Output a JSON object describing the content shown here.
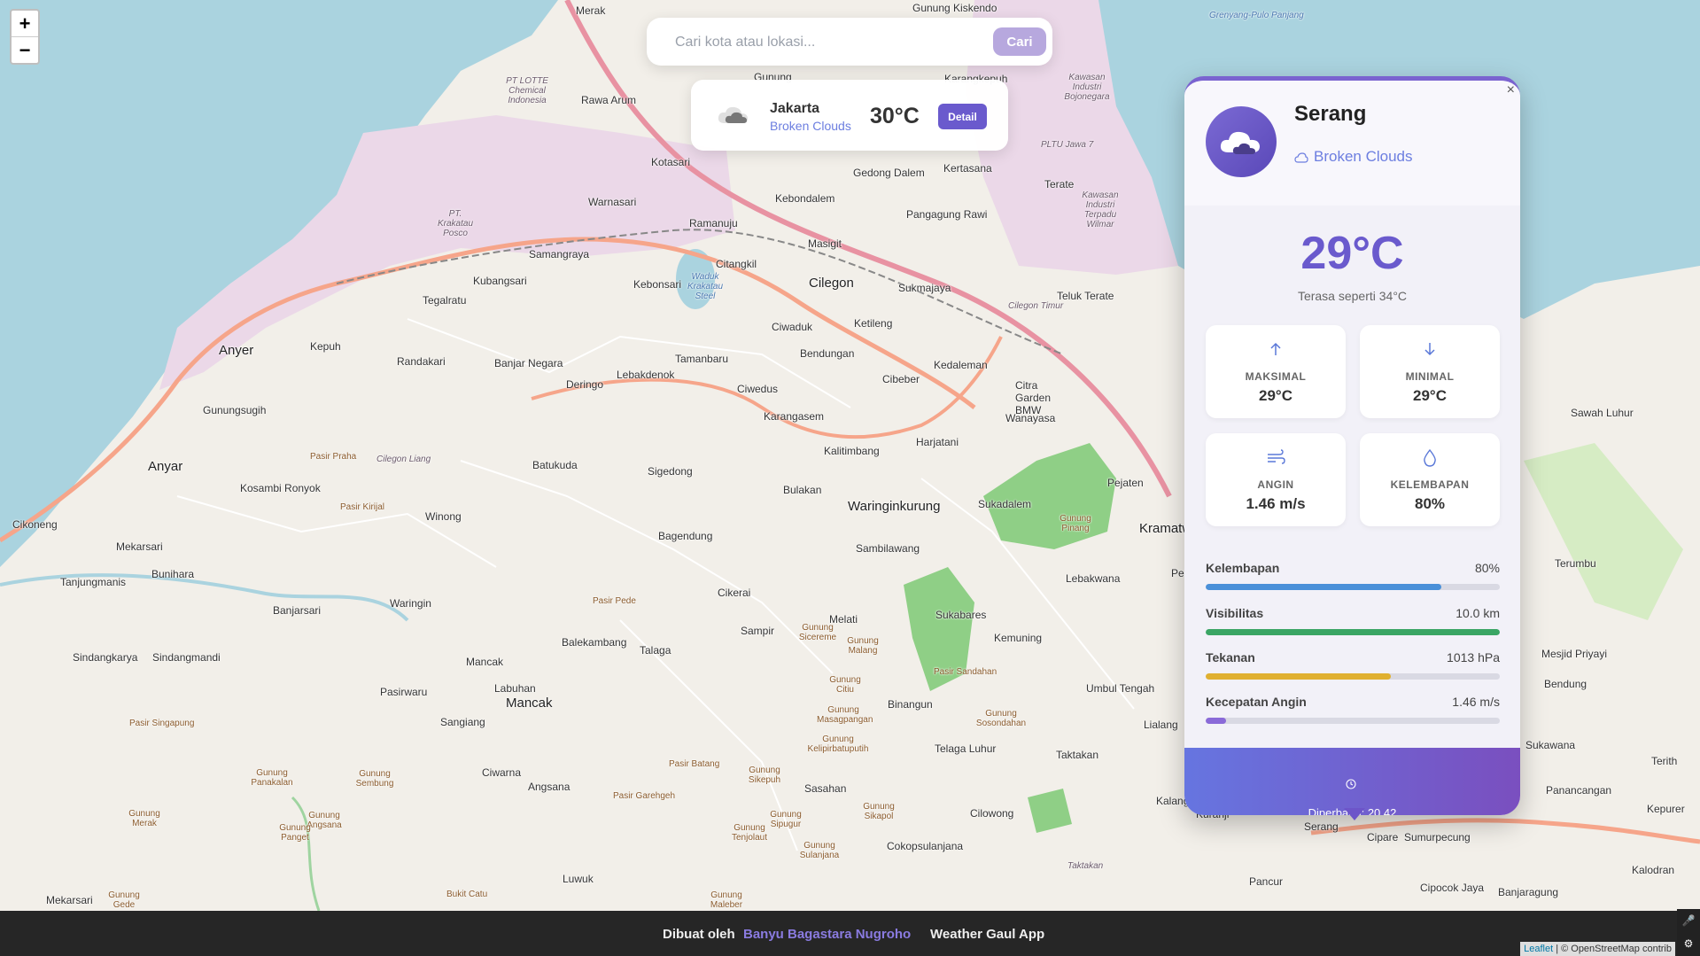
{
  "map": {
    "colors": {
      "sea": "#aad3df",
      "land": "#f2efe9",
      "industrial": "#ebd8e8",
      "forest": "#8fcf86",
      "motorway": "#e892a2",
      "primary": "#f6a58a"
    },
    "labels": [
      {
        "text": "Merak",
        "cls": ""
      },
      {
        "text": "Rawa Arum",
        "cls": ""
      },
      {
        "text": "Kotasari",
        "cls": ""
      },
      {
        "text": "Warnasari",
        "cls": ""
      },
      {
        "text": "Ramanuju",
        "cls": ""
      },
      {
        "text": "Kebondalem",
        "cls": ""
      },
      {
        "text": "Gedong Dalem",
        "cls": ""
      },
      {
        "text": "Kertasana",
        "cls": ""
      },
      {
        "text": "Pangagung Rawi",
        "cls": ""
      },
      {
        "text": "Masigit",
        "cls": ""
      },
      {
        "text": "Samangraya",
        "cls": ""
      },
      {
        "text": "Citangkil",
        "cls": ""
      },
      {
        "text": "Kubangsari",
        "cls": ""
      },
      {
        "text": "Kebonsari",
        "cls": ""
      },
      {
        "text": "Cilegon",
        "cls": "big"
      },
      {
        "text": "Sukmajaya",
        "cls": ""
      },
      {
        "text": "Tegalratu",
        "cls": ""
      },
      {
        "text": "Ciwaduk",
        "cls": ""
      },
      {
        "text": "Ketileng",
        "cls": ""
      },
      {
        "text": "Teluk Terate",
        "cls": ""
      },
      {
        "text": "Anyer",
        "cls": "big"
      },
      {
        "text": "Kepuh",
        "cls": ""
      },
      {
        "text": "Randakari",
        "cls": ""
      },
      {
        "text": "Banjar Negara",
        "cls": ""
      },
      {
        "text": "Tamanbaru",
        "cls": ""
      },
      {
        "text": "Bendungan",
        "cls": ""
      },
      {
        "text": "Kedaleman",
        "cls": ""
      },
      {
        "text": "Deringo",
        "cls": ""
      },
      {
        "text": "Lebakdenok",
        "cls": ""
      },
      {
        "text": "Ciwedus",
        "cls": ""
      },
      {
        "text": "Cibeber",
        "cls": ""
      },
      {
        "text": "Citra Garden BMW",
        "cls": ""
      },
      {
        "text": "Gunungsugih",
        "cls": ""
      },
      {
        "text": "Karangasem",
        "cls": ""
      },
      {
        "text": "Wanayasa",
        "cls": ""
      },
      {
        "text": "Harjatani",
        "cls": ""
      },
      {
        "text": "Kalitimbang",
        "cls": ""
      },
      {
        "text": "Anyar",
        "cls": "big"
      },
      {
        "text": "Batukuda",
        "cls": ""
      },
      {
        "text": "Sigedong",
        "cls": ""
      },
      {
        "text": "Kosambi Ronyok",
        "cls": ""
      },
      {
        "text": "Pejaten",
        "cls": ""
      },
      {
        "text": "Bulakan",
        "cls": ""
      },
      {
        "text": "Waringinkurung",
        "cls": "big"
      },
      {
        "text": "Sukadalem",
        "cls": ""
      },
      {
        "text": "Cikoneng",
        "cls": ""
      },
      {
        "text": "Winong",
        "cls": ""
      },
      {
        "text": "Bagendung",
        "cls": ""
      },
      {
        "text": "Kramatw",
        "cls": "big"
      },
      {
        "text": "Mekarsari",
        "cls": ""
      },
      {
        "text": "Sambilawang",
        "cls": ""
      },
      {
        "text": "Bunihara",
        "cls": ""
      },
      {
        "text": "Tanjungmanis",
        "cls": ""
      },
      {
        "text": "Lebakwana",
        "cls": ""
      },
      {
        "text": "Pelam",
        "cls": ""
      },
      {
        "text": "Cikerai",
        "cls": ""
      },
      {
        "text": "Banjarsari",
        "cls": ""
      },
      {
        "text": "Waringin",
        "cls": ""
      },
      {
        "text": "Sukabares",
        "cls": ""
      },
      {
        "text": "Melati",
        "cls": ""
      },
      {
        "text": "Sampir",
        "cls": ""
      },
      {
        "text": "Kemuning",
        "cls": ""
      },
      {
        "text": "Sindangkarya",
        "cls": ""
      },
      {
        "text": "Sindangmandi",
        "cls": ""
      },
      {
        "text": "Mancak",
        "cls": ""
      },
      {
        "text": "Balekambang",
        "cls": ""
      },
      {
        "text": "Talaga",
        "cls": ""
      },
      {
        "text": "Pasirwaru",
        "cls": ""
      },
      {
        "text": "Labuhan",
        "cls": ""
      },
      {
        "text": "Mancak",
        "cls": "big"
      },
      {
        "text": "Binangun",
        "cls": ""
      },
      {
        "text": "Umbul Tengah",
        "cls": ""
      },
      {
        "text": "Sangiang",
        "cls": ""
      },
      {
        "text": "Lialang",
        "cls": ""
      },
      {
        "text": "Telaga Luhur",
        "cls": ""
      },
      {
        "text": "Taktakan",
        "cls": ""
      },
      {
        "text": "Ciwarna",
        "cls": ""
      },
      {
        "text": "Angsana",
        "cls": ""
      },
      {
        "text": "Sasahan",
        "cls": ""
      },
      {
        "text": "Cilowong",
        "cls": ""
      },
      {
        "text": "Kalang Anyar",
        "cls": ""
      },
      {
        "text": "Kuranji",
        "cls": ""
      },
      {
        "text": "Serang",
        "cls": ""
      },
      {
        "text": "Cipare",
        "cls": ""
      },
      {
        "text": "Sumurpecung",
        "cls": ""
      },
      {
        "text": "Cokopsulanjana",
        "cls": ""
      },
      {
        "text": "Luwuk",
        "cls": ""
      },
      {
        "text": "Mekarsari",
        "cls": ""
      },
      {
        "text": "Pancur",
        "cls": ""
      },
      {
        "text": "Cipocok Jaya",
        "cls": ""
      },
      {
        "text": "Banjaragung",
        "cls": ""
      },
      {
        "text": "Sawah Luhur",
        "cls": ""
      },
      {
        "text": "Terumbu",
        "cls": ""
      },
      {
        "text": "Mesjid Priyayi",
        "cls": ""
      },
      {
        "text": "Bendung",
        "cls": ""
      },
      {
        "text": "Sukawana",
        "cls": ""
      },
      {
        "text": "Terith",
        "cls": ""
      },
      {
        "text": "Panancangan",
        "cls": ""
      },
      {
        "text": "Kepurer",
        "cls": ""
      },
      {
        "text": "Kalodran",
        "cls": ""
      },
      {
        "text": "Terate",
        "cls": ""
      },
      {
        "text": "Gunung Kiskendo",
        "cls": ""
      },
      {
        "text": "Gunung",
        "cls": ""
      },
      {
        "text": "Karangkepuh",
        "cls": ""
      }
    ],
    "areas": [
      {
        "text": "PT LOTTE Chemical Indonesia"
      },
      {
        "text": "PT. Krakatau Posco"
      },
      {
        "text": "Kawasan Industri Bojonegara"
      },
      {
        "text": "PLTU Jawa 7"
      },
      {
        "text": "Kawasan Industri Terpadu Wilmar"
      },
      {
        "text": "Waduk Krakatau Steel"
      },
      {
        "text": "Cilegon Timur"
      },
      {
        "text": "Grenyang-Pulo Panjang"
      },
      {
        "text": "Cilegon Liang"
      },
      {
        "text": "Taktakan"
      }
    ],
    "peaks": [
      {
        "text": "Pasir Praha"
      },
      {
        "text": "Pasir Kirijal"
      },
      {
        "text": "Pasir Pede"
      },
      {
        "text": "Gunung Sicereme"
      },
      {
        "text": "Gunung Malang"
      },
      {
        "text": "Gunung Citiu"
      },
      {
        "text": "Gunung Masagpangan"
      },
      {
        "text": "Gunung Kelipirbatuputih"
      },
      {
        "text": "Pasir Sandahan"
      },
      {
        "text": "Gunung Sosondahan"
      },
      {
        "text": "Pasir Singapung"
      },
      {
        "text": "Gunung Panakalan"
      },
      {
        "text": "Gunung Sembung"
      },
      {
        "text": "Gunung Merak"
      },
      {
        "text": "Gunung Angsana"
      },
      {
        "text": "Gunung Panget"
      },
      {
        "text": "Pasir Batang"
      },
      {
        "text": "Gunung Sikepuh"
      },
      {
        "text": "Pasir Garehgeh"
      },
      {
        "text": "Gunung Sipugur"
      },
      {
        "text": "Gunung Tenjolaut"
      },
      {
        "text": "Gunung Sulanjana"
      },
      {
        "text": "Gunung Sikapol"
      },
      {
        "text": "Gunung Gede"
      },
      {
        "text": "Bukit Catu"
      },
      {
        "text": "Gunung Maleber"
      },
      {
        "text": "Gunung Pinang"
      }
    ]
  },
  "zoom": {
    "in": "+",
    "out": "−"
  },
  "search": {
    "placeholder": "Cari kota atau lokasi...",
    "button": "Cari"
  },
  "mini_card": {
    "city": "Jakarta",
    "desc": "Broken Clouds",
    "temp": "30°C",
    "button": "Detail",
    "icon": "cloud-icon"
  },
  "popup": {
    "close": "×",
    "city": "Serang",
    "desc": "Broken Clouds",
    "temp": "29°C",
    "feels": "Terasa seperti 34°C",
    "cards": [
      {
        "icon": "arrow-up-icon",
        "label": "MAKSIMAL",
        "value": "29°C"
      },
      {
        "icon": "arrow-down-icon",
        "label": "MINIMAL",
        "value": "29°C"
      },
      {
        "icon": "wind-icon",
        "label": "ANGIN",
        "value": "1.46 m/s"
      },
      {
        "icon": "droplet-icon",
        "label": "KELEMBAPAN",
        "value": "80%"
      }
    ],
    "bars": [
      {
        "label": "Kelembapan",
        "value": "80%",
        "level": 0.8,
        "color": "#4a90d9"
      },
      {
        "label": "Visibilitas",
        "value": "10.0 km",
        "level": 1.0,
        "color": "#3aa564"
      },
      {
        "label": "Tekanan",
        "value": "1013 hPa",
        "level": 0.63,
        "color": "#e0b030"
      },
      {
        "label": "Kecepatan Angin",
        "value": "1.46 m/s",
        "level": 0.07,
        "color": "#8a6ad8"
      }
    ],
    "updated": "Diperbarui: 20.42"
  },
  "footer": {
    "made_by": "Dibuat oleh",
    "author": "Banyu Bagastara Nugroho",
    "app": "Weather Gaul App"
  },
  "attribution": {
    "leaflet": "Leaflet",
    "rest": "| © OpenStreetMap contrib"
  },
  "colors": {
    "accent": "#6a5acd",
    "desc": "#6c7ee0",
    "footer": "#262626"
  }
}
